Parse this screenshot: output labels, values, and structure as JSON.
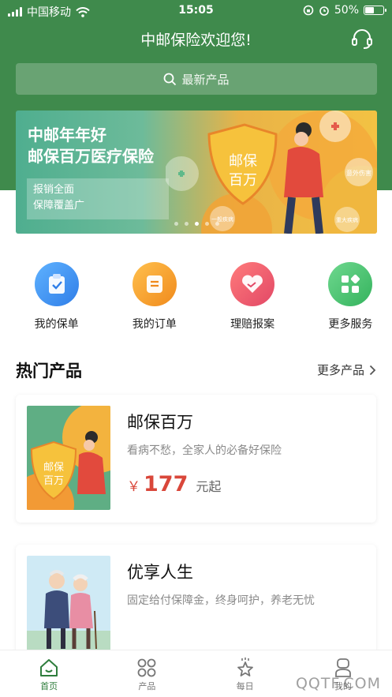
{
  "status_bar": {
    "carrier": "中国移动",
    "time": "15:05",
    "battery_percent": "50%",
    "battery_level": 0.5
  },
  "header": {
    "title": "中邮保险欢迎您!",
    "service_icon": "headset-icon"
  },
  "search": {
    "placeholder": "最新产品",
    "icon": "search-icon"
  },
  "banner": {
    "title_line1": "中邮年年好",
    "title_line2": "邮保百万医疗保险",
    "sub_line1": "报销全面",
    "sub_line2": "保障覆盖广",
    "shield_text_1": "邮保",
    "shield_text_2": "百万",
    "bubble_1": "意外伤害",
    "bubble_2": "一般疾病",
    "bubble_3": "重大疾病",
    "slide_count": 5,
    "active_slide": 2
  },
  "quick_actions": [
    {
      "label": "我的保单",
      "icon": "policy-icon",
      "color": "#3b8ff0"
    },
    {
      "label": "我的订单",
      "icon": "order-icon",
      "color": "#f5a623"
    },
    {
      "label": "理赔报案",
      "icon": "claim-handshake-icon",
      "color": "#ef5a6e"
    },
    {
      "label": "更多服务",
      "icon": "more-services-icon",
      "color": "#4cc675"
    }
  ],
  "hot_products": {
    "title": "热门产品",
    "more_label": "更多产品",
    "items": [
      {
        "name": "邮保百万",
        "desc": "看病不愁，全家人的必备好保险",
        "currency": "￥",
        "price": "177",
        "unit": "元起",
        "image_text_1": "邮保",
        "image_text_2": "百万"
      },
      {
        "name": "优享人生",
        "desc": "固定给付保障金，终身呵护，养老无忧"
      }
    ]
  },
  "tabbar": [
    {
      "label": "首页",
      "icon": "home-icon",
      "active": true
    },
    {
      "label": "产品",
      "icon": "products-grid-icon",
      "active": false
    },
    {
      "label": "每日",
      "icon": "daily-star-icon",
      "active": false
    },
    {
      "label": "我的",
      "icon": "profile-icon",
      "active": false
    }
  ],
  "watermark": "QQTF.COM",
  "colors": {
    "brand_green": "#3f8a4c",
    "price_red": "#d9473a"
  }
}
